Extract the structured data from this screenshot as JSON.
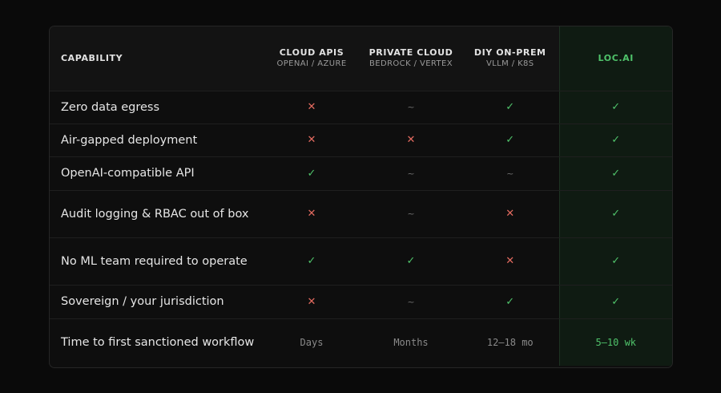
{
  "header": {
    "capability": "CAPABILITY",
    "columns": [
      {
        "title": "CLOUD APIS",
        "subtitle": "OPENAI / AZURE"
      },
      {
        "title": "PRIVATE CLOUD",
        "subtitle": "BEDROCK / VERTEX"
      },
      {
        "title": "DIY ON-PREM",
        "subtitle": "VLLM / K8S"
      },
      {
        "title": "LOC.AI",
        "subtitle": ""
      }
    ]
  },
  "glyphs": {
    "yes": "✓",
    "no": "✕",
    "partial": "~"
  },
  "rows": [
    {
      "label": "Zero data egress",
      "values": [
        "no",
        "partial",
        "yes",
        "yes"
      ]
    },
    {
      "label": "Air-gapped deployment",
      "values": [
        "no",
        "no",
        "yes",
        "yes"
      ]
    },
    {
      "label": "OpenAI-compatible API",
      "values": [
        "yes",
        "partial",
        "partial",
        "yes"
      ]
    },
    {
      "label": "Audit logging & RBAC out of box",
      "values": [
        "no",
        "partial",
        "no",
        "yes"
      ]
    },
    {
      "label": "No ML team required to operate",
      "values": [
        "yes",
        "yes",
        "no",
        "yes"
      ]
    },
    {
      "label": "Sovereign / your jurisdiction",
      "values": [
        "no",
        "partial",
        "yes",
        "yes"
      ]
    }
  ],
  "time_row": {
    "label": "Time to first sanctioned workflow",
    "values": [
      "Days",
      "Months",
      "12–18 mo",
      "5–10 wk"
    ]
  },
  "colors": {
    "accent": "#4fc26a",
    "negative": "#e46b60",
    "neutral": "#6e6e6e",
    "background": "#0a0a0a"
  }
}
